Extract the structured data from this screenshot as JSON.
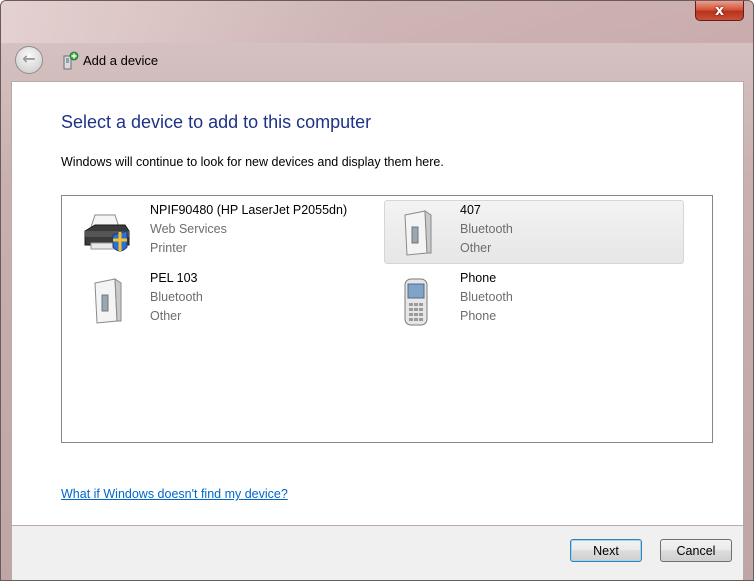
{
  "window": {
    "close_label": "x"
  },
  "nav": {
    "title": "Add a device",
    "back_icon": "back-arrow-icon",
    "title_icon": "add-device-icon"
  },
  "main": {
    "heading": "Select a device to add to this computer",
    "subtext": "Windows will continue to look for new devices and display them here.",
    "link": "What if Windows doesn't find my device?"
  },
  "devices": [
    {
      "name": "NPIF90480 (HP LaserJet P2055dn)",
      "line1": "Web Services",
      "line2": "Printer",
      "icon": "printer-icon",
      "selected": false
    },
    {
      "name": "407",
      "line1": "Bluetooth",
      "line2": "Other",
      "icon": "bluetooth-device-icon",
      "selected": true
    },
    {
      "name": "PEL 103",
      "line1": "Bluetooth",
      "line2": "Other",
      "icon": "bluetooth-device-icon",
      "selected": false
    },
    {
      "name": "Phone",
      "line1": "Bluetooth",
      "line2": "Phone",
      "icon": "mobile-phone-icon",
      "selected": false
    }
  ],
  "footer": {
    "next_label": "Next",
    "cancel_label": "Cancel"
  },
  "colors": {
    "heading": "#1e3287",
    "link": "#0066cc",
    "close": "#c8523a"
  }
}
